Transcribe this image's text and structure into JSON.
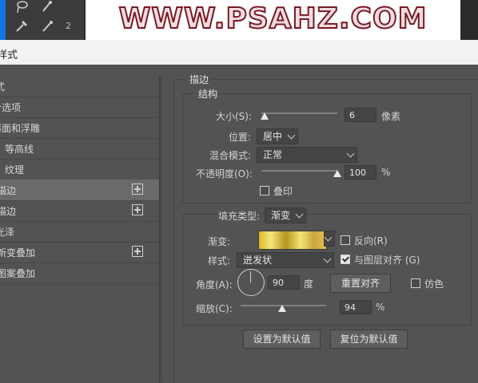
{
  "background": {
    "banner_text": "WWW.PSAHZ.COM",
    "tool_number": "2",
    "accent_color": "#1473e6"
  },
  "dialog": {
    "title": "样式"
  },
  "left_panel": {
    "items": [
      {
        "label": "式",
        "plus": false,
        "selected": false
      },
      {
        "label": "合选项",
        "plus": false,
        "selected": false
      },
      {
        "label": "斜面和浮雕",
        "plus": false,
        "selected": false
      },
      {
        "label": "等高线",
        "plus": false,
        "selected": false
      },
      {
        "label": "纹理",
        "plus": false,
        "selected": false
      },
      {
        "label": "描边",
        "plus": true,
        "selected": true
      },
      {
        "label": "描边",
        "plus": true,
        "selected": false
      },
      {
        "label": "光泽",
        "plus": false,
        "selected": false
      },
      {
        "label": "新变叠加",
        "plus": true,
        "selected": false
      },
      {
        "label": "图案叠加",
        "plus": false,
        "selected": false
      }
    ]
  },
  "stroke": {
    "section_title": "描边",
    "structure_title": "结构",
    "size_label": "大小(S):",
    "size_value": "6",
    "size_unit": "像素",
    "size_slider": 0.04,
    "position_label": "位置:",
    "position_value": "居中",
    "blend_label": "混合模式:",
    "blend_value": "正常",
    "opacity_label": "不透明度(O):",
    "opacity_value": "100",
    "opacity_unit": "%",
    "opacity_slider": 1.0,
    "overprint_label": "叠印",
    "overprint_checked": false,
    "fill_type_label": "填充类型:",
    "fill_type_value": "渐变",
    "gradient_label": "渐变:",
    "reverse_label": "反向(R)",
    "reverse_checked": false,
    "style_label": "样式:",
    "style_value": "迸发状",
    "align_label": "与图层对齐 (G)",
    "align_checked": true,
    "angle_label": "角度(A):",
    "angle_value": "90",
    "angle_unit": "度",
    "reset_align_label": "重置对齐",
    "dither_label": "仿色",
    "dither_checked": false,
    "scale_label": "缩放(C):",
    "scale_value": "94",
    "scale_unit": "%",
    "scale_slider": 0.49
  },
  "buttons": {
    "set_default": "设置为默认值",
    "reset_default": "复位为默认值"
  }
}
